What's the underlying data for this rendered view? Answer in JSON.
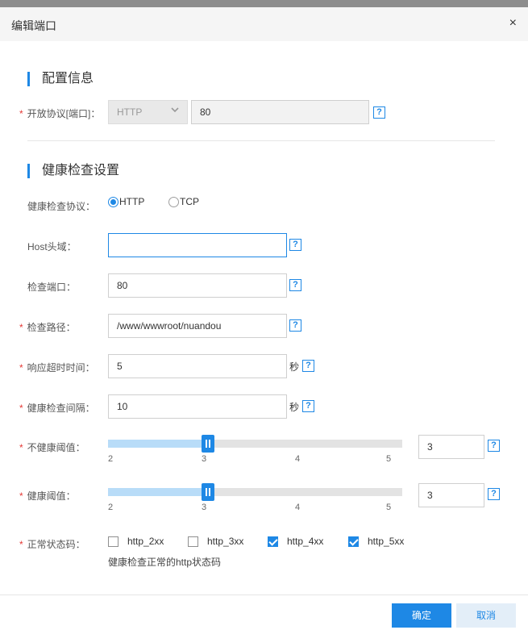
{
  "dialog": {
    "title": "编辑端口",
    "close_icon": "×"
  },
  "colors": {
    "accent": "#1e88e5",
    "required": "#e53935"
  },
  "config_section": {
    "title": "配置信息",
    "open_protocol_label": "开放协议[端口]：",
    "protocol_value": "HTTP",
    "port_value": "80",
    "help": "?"
  },
  "health_section": {
    "title": "健康检查设置",
    "protocol_label": "健康检查协议：",
    "protocol_options": [
      "HTTP",
      "TCP"
    ],
    "selected_protocol": "HTTP",
    "host_label": "Host头域：",
    "host_value": "",
    "port_label": "检查端口：",
    "port_value": "80",
    "path_label": "检查路径：",
    "path_value": "/www/wwwroot/nuandou",
    "timeout_label": "响应超时时间：",
    "timeout_value": "5",
    "timeout_unit": "秒",
    "interval_label": "健康检查间隔：",
    "interval_value": "10",
    "interval_unit": "秒",
    "unhealthy_label": "不健康阈值：",
    "unhealthy_value": "3",
    "healthy_label": "健康阈值：",
    "healthy_value": "3",
    "slider_ticks": [
      "2",
      "3",
      "4",
      "5"
    ],
    "slider_range": [
      2,
      5
    ],
    "status_label": "正常状态码：",
    "status_codes": [
      {
        "label": "http_2xx",
        "checked": false
      },
      {
        "label": "http_3xx",
        "checked": false
      },
      {
        "label": "http_4xx",
        "checked": true
      },
      {
        "label": "http_5xx",
        "checked": true
      }
    ],
    "status_hint": "健康检查正常的http状态码",
    "help": "?"
  },
  "footer": {
    "confirm": "确定",
    "cancel": "取消"
  }
}
